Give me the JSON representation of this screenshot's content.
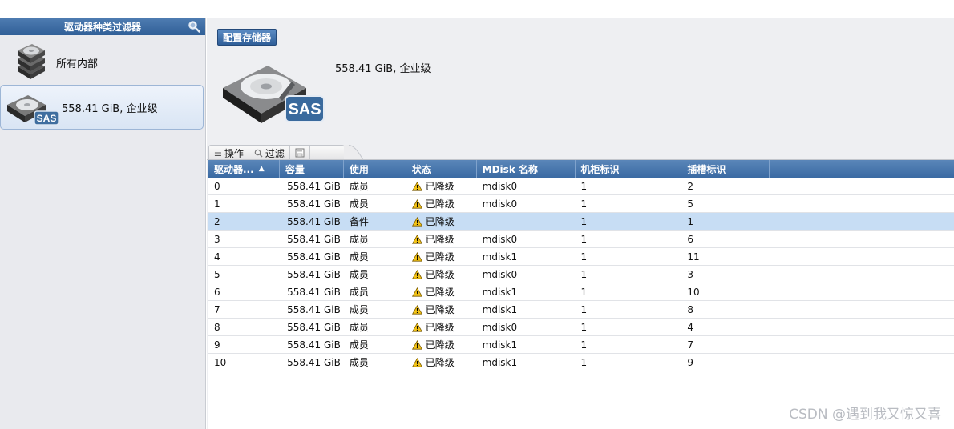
{
  "left_panel": {
    "title": "驱动器种类过滤器",
    "items": [
      {
        "label": "所有内部"
      },
      {
        "label": "558.41 GiB, 企业级",
        "badge": "SAS"
      }
    ]
  },
  "main": {
    "config_button": "配置存储器",
    "drive_badge": "SAS",
    "summary": "558.41 GiB, 企业级",
    "toolbar": {
      "actions": "操作",
      "filter": "过滤"
    },
    "columns": [
      "驱动器...",
      "容量",
      "使用",
      "状态",
      "MDisk 名称",
      "机柜标识",
      "插槽标识",
      ""
    ],
    "sort_indicator": "▲",
    "rows": [
      {
        "id": "0",
        "capacity": "558.41 GiB",
        "use": "成员",
        "status": "已降级",
        "mdisk": "mdisk0",
        "enclosure": "1",
        "slot": "2"
      },
      {
        "id": "1",
        "capacity": "558.41 GiB",
        "use": "成员",
        "status": "已降级",
        "mdisk": "mdisk0",
        "enclosure": "1",
        "slot": "5"
      },
      {
        "id": "2",
        "capacity": "558.41 GiB",
        "use": "备件",
        "status": "已降级",
        "mdisk": "",
        "enclosure": "1",
        "slot": "1"
      },
      {
        "id": "3",
        "capacity": "558.41 GiB",
        "use": "成员",
        "status": "已降级",
        "mdisk": "mdisk0",
        "enclosure": "1",
        "slot": "6"
      },
      {
        "id": "4",
        "capacity": "558.41 GiB",
        "use": "成员",
        "status": "已降级",
        "mdisk": "mdisk1",
        "enclosure": "1",
        "slot": "11"
      },
      {
        "id": "5",
        "capacity": "558.41 GiB",
        "use": "成员",
        "status": "已降级",
        "mdisk": "mdisk0",
        "enclosure": "1",
        "slot": "3"
      },
      {
        "id": "6",
        "capacity": "558.41 GiB",
        "use": "成员",
        "status": "已降级",
        "mdisk": "mdisk1",
        "enclosure": "1",
        "slot": "10"
      },
      {
        "id": "7",
        "capacity": "558.41 GiB",
        "use": "成员",
        "status": "已降级",
        "mdisk": "mdisk1",
        "enclosure": "1",
        "slot": "8"
      },
      {
        "id": "8",
        "capacity": "558.41 GiB",
        "use": "成员",
        "status": "已降级",
        "mdisk": "mdisk0",
        "enclosure": "1",
        "slot": "4"
      },
      {
        "id": "9",
        "capacity": "558.41 GiB",
        "use": "成员",
        "status": "已降级",
        "mdisk": "mdisk1",
        "enclosure": "1",
        "slot": "7"
      },
      {
        "id": "10",
        "capacity": "558.41 GiB",
        "use": "成员",
        "status": "已降级",
        "mdisk": "mdisk1",
        "enclosure": "1",
        "slot": "9"
      }
    ],
    "selected_row": 2
  },
  "watermark": "CSDN @遇到我又惊又喜",
  "colors": {
    "header_blue": "#3a6aa3",
    "selected_row": "#c7ddf4",
    "warning": "#f3c316"
  },
  "icons": [
    "search-icon",
    "hard-drive-stack-icon",
    "hard-drive-sas-icon",
    "list-icon",
    "filter-icon",
    "save-icon",
    "warning-icon"
  ]
}
